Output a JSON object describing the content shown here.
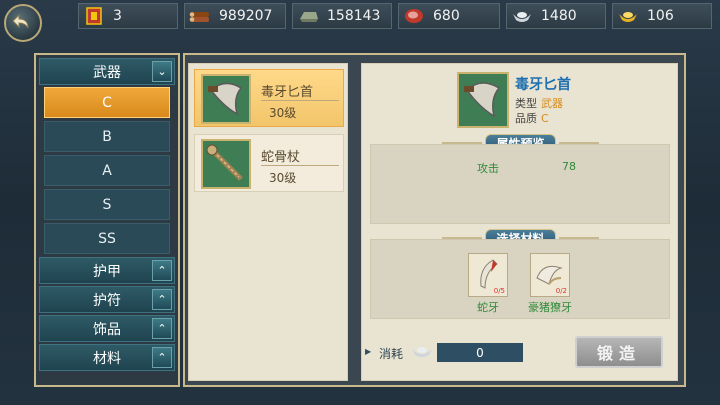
{
  "resources": [
    {
      "icon": "flag-token-icon",
      "value": "3"
    },
    {
      "icon": "wood-icon",
      "value": "989207"
    },
    {
      "icon": "iron-ingot-icon",
      "value": "158143"
    },
    {
      "icon": "meat-icon",
      "value": "680"
    },
    {
      "icon": "silver-ingot-icon",
      "value": "1480"
    },
    {
      "icon": "gold-ingot-icon",
      "value": "106"
    }
  ],
  "nav": {
    "weapons": "武器",
    "grades": [
      "C",
      "B",
      "A",
      "S",
      "SS"
    ],
    "armor": "护甲",
    "amulet": "护符",
    "accessory": "饰品",
    "materials": "材料"
  },
  "items": [
    {
      "name": "毒牙匕首",
      "level": "30级"
    },
    {
      "name": "蛇骨杖",
      "level": "30级"
    }
  ],
  "detail": {
    "name": "毒牙匕首",
    "type_label": "类型",
    "type_value": "武器",
    "quality_label": "品质",
    "quality_value": "C",
    "attr_header": "属性预览",
    "attr_name": "攻击",
    "attr_value": "78",
    "mat_header": "选择材料",
    "materials": [
      {
        "name": "蛇牙",
        "count": "0/5"
      },
      {
        "name": "豪猪獠牙",
        "count": "0/2"
      }
    ]
  },
  "cost": {
    "label": "消耗",
    "value": "0"
  },
  "forge_button": "锻造",
  "colors": {
    "accent": "#f0a83a",
    "frame_gold": "#c8b98a",
    "text_green": "#2f8a3a",
    "title_blue": "#1e6fb0"
  }
}
